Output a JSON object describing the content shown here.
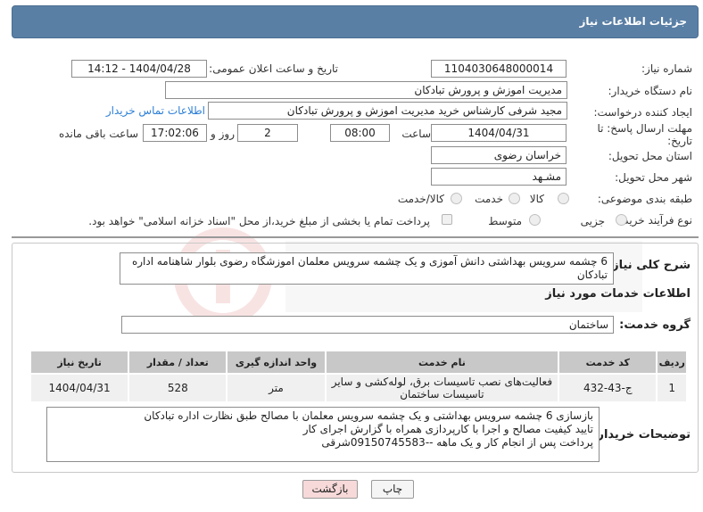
{
  "header": {
    "title": "جزئیات اطلاعات نیاز"
  },
  "form": {
    "need_number": {
      "label": "شماره نیاز:",
      "value": "1104030648000014"
    },
    "announce_datetime": {
      "label": "تاریخ و ساعت اعلان عمومی:",
      "value": "1404/04/28 - 14:12"
    },
    "buyer_org": {
      "label": "نام دستگاه خریدار:",
      "value": "مدیریت اموزش و پرورش تبادکان"
    },
    "creator": {
      "label": "ایجاد کننده درخواست:",
      "value": "مجید شرفی کارشناس خرید مدیریت اموزش و پرورش تبادکان",
      "contact_link": "اطلاعات تماس خریدار"
    },
    "deadline": {
      "label": "مهلت ارسال پاسخ: تا تاریخ:",
      "date": "1404/04/31",
      "time_label": "ساعت",
      "time": "08:00",
      "days": "2",
      "days_label": "روز و",
      "remaining": "17:02:06",
      "remaining_label": "ساعت باقی مانده"
    },
    "province": {
      "label": "استان محل تحویل:",
      "value": "خراسان رضوی"
    },
    "city": {
      "label": "شهر محل تحویل:",
      "value": "مشـهد"
    },
    "category": {
      "label": "طبقه بندی موضوعی:",
      "options": [
        "کالا",
        "خدمت",
        "کالا/خدمت"
      ]
    },
    "process": {
      "label": "نوع فرآیند خرید :",
      "options": [
        "جزیی",
        "متوسط"
      ],
      "payment_note": "پرداخت تمام یا بخشی از مبلغ خرید،از محل \"اسناد خزانه اسلامی\" خواهد بود."
    }
  },
  "summary": {
    "label": "شرح کلی نیاز:",
    "text": "6 چشمه سرویس بهداشتی دانش آموزی و یک چشمه سرویس معلمان اموزشگاه رضوی بلوار شاهنامه اداره تبادکان"
  },
  "services": {
    "title": "اطلاعات خدمات مورد نیاز",
    "group_label": "گروه خدمت:",
    "group_value": "ساختمان",
    "table": {
      "headers": [
        "ردیف",
        "کد خدمت",
        "نام خدمت",
        "واحد اندازه گیری",
        "تعداد / مقدار",
        "تاریخ نیاز"
      ],
      "rows": [
        [
          "1",
          "ج-43-432",
          "فعالیت‌های نصب تاسیسات برق، لوله‌کشی و سایر تاسیسات ساختمان",
          "متر",
          "528",
          "1404/04/31"
        ]
      ]
    }
  },
  "buyer_notes": {
    "label": "توضیحات خریدار:",
    "lines": [
      "بازسازی 6 چشمه سرویس بهداشتی و یک چشمه سرویس معلمان با مصالح طبق نظارت اداره تبادکان",
      "تایید کیفیت مصالح و اجرا با کارپردازی همراه با گزارش اجرای کار",
      "پرداخت پس از انجام کار و یک ماهه --09150745583شرقی"
    ]
  },
  "buttons": {
    "print": "چاپ",
    "back": "بازگشت"
  },
  "colors": {
    "header_bg": "#5a7fa5",
    "link": "#2d7fd6",
    "back_button_bg": "#f7d9d9"
  }
}
